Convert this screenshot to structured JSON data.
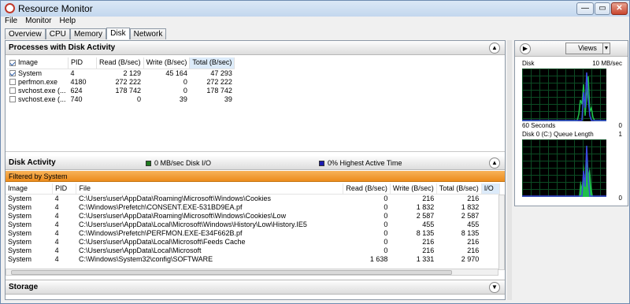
{
  "window": {
    "title": "Resource Monitor",
    "min": "—",
    "max": "▭",
    "close": "✕"
  },
  "menu": [
    "File",
    "Monitor",
    "Help"
  ],
  "tabs": [
    "Overview",
    "CPU",
    "Memory",
    "Disk",
    "Network"
  ],
  "processes": {
    "title": "Processes with Disk Activity",
    "columns": [
      "Image",
      "PID",
      "Read (B/sec)",
      "Write (B/sec)",
      "Total (B/sec)"
    ],
    "rows": [
      {
        "checked": true,
        "image": "System",
        "pid": "4",
        "read": "2 129",
        "write": "45 164",
        "total": "47 293"
      },
      {
        "checked": false,
        "image": "perfmon.exe",
        "pid": "4180",
        "read": "272 222",
        "write": "0",
        "total": "272 222"
      },
      {
        "checked": false,
        "image": "svchost.exe (...",
        "pid": "624",
        "read": "178 742",
        "write": "0",
        "total": "178 742"
      },
      {
        "checked": false,
        "image": "svchost.exe (...",
        "pid": "740",
        "read": "0",
        "write": "39",
        "total": "39"
      }
    ]
  },
  "disk_activity": {
    "title": "Disk Activity",
    "io_label": "0 MB/sec Disk I/O",
    "active_label": "0% Highest Active Time",
    "io_color": "#1e7a1e",
    "active_color": "#1a1ab0",
    "filter": "Filtered by System",
    "columns": [
      "Image",
      "PID",
      "File",
      "Read (B/sec)",
      "Write (B/sec)",
      "Total (B/sec)",
      "I/O"
    ],
    "rows": [
      {
        "image": "System",
        "pid": "4",
        "file": "C:\\Users\\user\\AppData\\Roaming\\Microsoft\\Windows\\Cookies",
        "read": "0",
        "write": "216",
        "total": "216"
      },
      {
        "image": "System",
        "pid": "4",
        "file": "C:\\Windows\\Prefetch\\CONSENT.EXE-531BD9EA.pf",
        "read": "0",
        "write": "1 832",
        "total": "1 832"
      },
      {
        "image": "System",
        "pid": "4",
        "file": "C:\\Users\\user\\AppData\\Roaming\\Microsoft\\Windows\\Cookies\\Low",
        "read": "0",
        "write": "2 587",
        "total": "2 587"
      },
      {
        "image": "System",
        "pid": "4",
        "file": "C:\\Users\\user\\AppData\\Local\\Microsoft\\Windows\\History\\Low\\History.IE5",
        "read": "0",
        "write": "455",
        "total": "455"
      },
      {
        "image": "System",
        "pid": "4",
        "file": "C:\\Windows\\Prefetch\\PERFMON.EXE-E34F662B.pf",
        "read": "0",
        "write": "8 135",
        "total": "8 135"
      },
      {
        "image": "System",
        "pid": "4",
        "file": "C:\\Users\\user\\AppData\\Local\\Microsoft\\Feeds Cache",
        "read": "0",
        "write": "216",
        "total": "216"
      },
      {
        "image": "System",
        "pid": "4",
        "file": "C:\\Users\\user\\AppData\\Local\\Microsoft",
        "read": "0",
        "write": "216",
        "total": "216"
      },
      {
        "image": "System",
        "pid": "4",
        "file": "C:\\Windows\\System32\\config\\SOFTWARE",
        "read": "1 638",
        "write": "1 331",
        "total": "2 970"
      }
    ]
  },
  "storage": {
    "title": "Storage"
  },
  "side": {
    "views": "Views",
    "disk_label": "Disk",
    "disk_max": "10 MB/sec",
    "disk_time": "60 Seconds",
    "disk_min": "0",
    "queue_label": "Disk 0 (C:) Queue Length",
    "queue_max": "1",
    "queue_min": "0"
  }
}
